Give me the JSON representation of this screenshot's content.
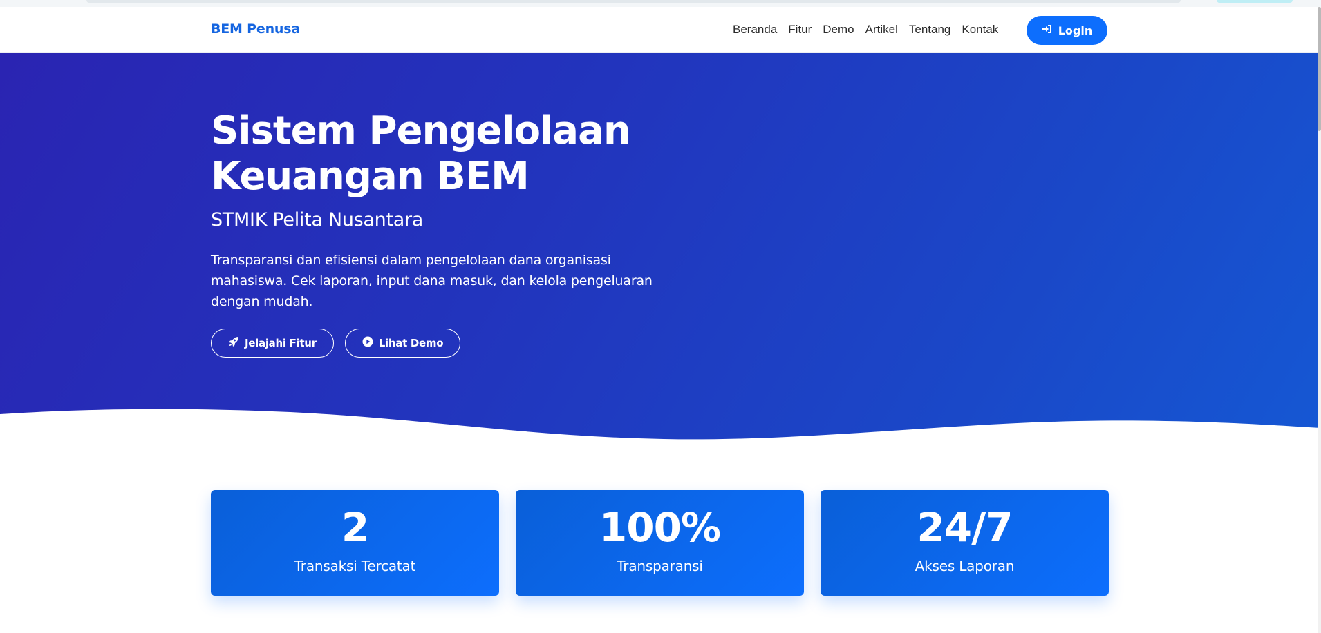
{
  "navbar": {
    "brand": "BEM Penusa",
    "links": [
      "Beranda",
      "Fitur",
      "Demo",
      "Artikel",
      "Tentang",
      "Kontak"
    ],
    "login_label": "Login"
  },
  "hero": {
    "title": "Sistem Pengelolaan Keuangan BEM",
    "subtitle": "STMIK Pelita Nusantara",
    "description": "Transparansi dan efisiensi dalam pengelolaan dana organisasi mahasiswa. Cek laporan, input dana masuk, dan kelola pengeluaran dengan mudah.",
    "buttons": [
      {
        "label": "Jelajahi Fitur",
        "icon": "rocket-icon"
      },
      {
        "label": "Lihat Demo",
        "icon": "play-circle-icon"
      }
    ]
  },
  "stats": [
    {
      "value": "2",
      "label": "Transaksi Tercatat"
    },
    {
      "value": "100%",
      "label": "Transparansi"
    },
    {
      "value": "24/7",
      "label": "Akses Laporan"
    }
  ],
  "colors": {
    "primary": "#0d6efd",
    "brand_text": "#1565e0",
    "hero_start": "#2a24b2",
    "hero_end": "#1558d4"
  }
}
